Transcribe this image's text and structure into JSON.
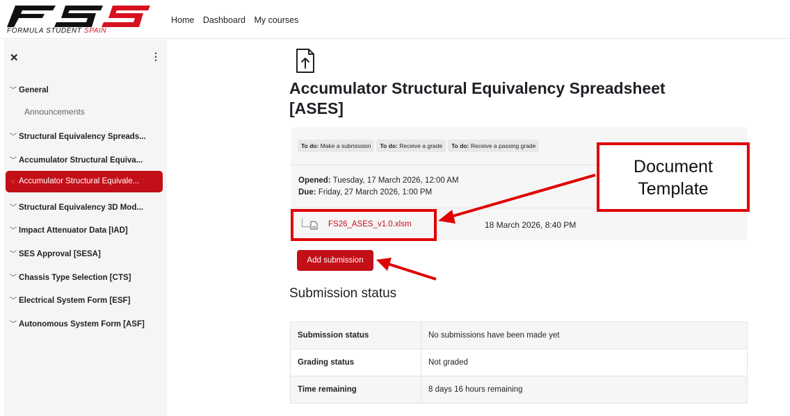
{
  "brand": {
    "logo_text": "FSS",
    "tagline_black": "FORMULA STUDENT",
    "tagline_red": "SPAIN",
    "colors": {
      "red": "#d8111e",
      "black": "#111111"
    }
  },
  "nav": {
    "links": [
      "Home",
      "Dashboard",
      "My courses"
    ]
  },
  "sidebar": {
    "close_icon": "close-icon",
    "menu_icon": "kebab-menu-icon",
    "items": [
      {
        "label": "General"
      },
      {
        "label": "Announcements"
      },
      {
        "label": "Structural Equivalency Spreads..."
      },
      {
        "label": "Accumulator Structural Equiva..."
      },
      {
        "label": "Accumulator Structural Equivale..."
      },
      {
        "label": "Structural Equivalency 3D Mod..."
      },
      {
        "label": "Impact Attenuator Data [IAD]"
      },
      {
        "label": "SES Approval [SESA]"
      },
      {
        "label": "Chassis Type Selection [CTS]"
      },
      {
        "label": "Electrical System Form [ESF]"
      },
      {
        "label": "Autonomous System Form [ASF]"
      }
    ],
    "active_index": 4
  },
  "main": {
    "icon": "upload-file-icon",
    "title": "Accumulator Structural Equivalency Spreadsheet [ASES]",
    "todos": [
      {
        "prefix": "To do:",
        "text": "Make a submission"
      },
      {
        "prefix": "To do:",
        "text": "Receive a grade"
      },
      {
        "prefix": "To do:",
        "text": "Receive a passing grade"
      }
    ],
    "opened_label": "Opened:",
    "opened_value": "Tuesday, 17 March 2026, 12:00 AM",
    "due_label": "Due:",
    "due_value": "Friday, 27 March 2026, 1:00 PM",
    "file_name": "FS26_ASES_v1.0.xlsm",
    "file_date": "18 March 2026, 8:40 PM",
    "add_submission": "Add submission",
    "submission_heading": "Submission status",
    "status_rows": [
      {
        "label": "Submission status",
        "value": "No submissions have been made yet"
      },
      {
        "label": "Grading status",
        "value": "Not graded"
      },
      {
        "label": "Time remaining",
        "value": "8 days 16 hours remaining"
      }
    ],
    "accent": "#c30f17"
  },
  "annotation": {
    "line1": "Document",
    "line2": "Template",
    "color": "#e00000"
  }
}
